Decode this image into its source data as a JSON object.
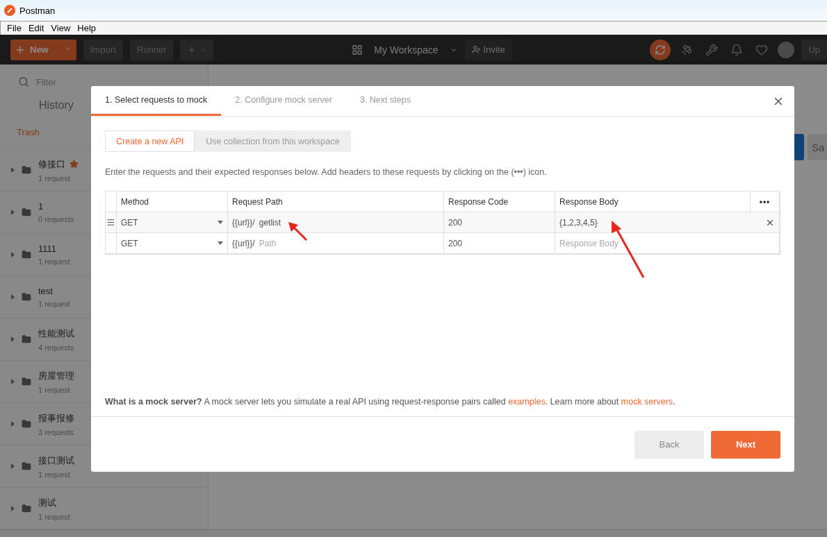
{
  "window": {
    "title": "Postman"
  },
  "menu": [
    "File",
    "Edit",
    "View",
    "Help"
  ],
  "toolbar": {
    "new_button": "New",
    "import_button": "Import",
    "runner_button": "Runner",
    "workspace": "My Workspace",
    "invite_button": "Invite",
    "upgrade_button": "Up"
  },
  "sidebar": {
    "filter_placeholder": "Filter",
    "history_tab": "History",
    "trash_link": "Trash",
    "collections": [
      {
        "name": "修接口",
        "count": "1 request",
        "starred": true
      },
      {
        "name": "1",
        "count": "0 requests",
        "starred": false
      },
      {
        "name": "1111",
        "count": "1 request",
        "starred": false
      },
      {
        "name": "test",
        "count": "1 request",
        "starred": false
      },
      {
        "name": "性能测试",
        "count": "4 requests",
        "starred": false
      },
      {
        "name": "房屋管理",
        "count": "1 request",
        "starred": false
      },
      {
        "name": "报事报修",
        "count": "3 requests",
        "starred": false
      },
      {
        "name": "接口测试",
        "count": "1 request",
        "starred": false
      },
      {
        "name": "测试",
        "count": "1 request",
        "starred": false
      }
    ]
  },
  "main": {
    "save_button": "Sa"
  },
  "modal": {
    "steps": [
      {
        "label": "1. Select requests to mock",
        "selected": true
      },
      {
        "label": "2. Configure mock server",
        "selected": false
      },
      {
        "label": "3. Next steps",
        "selected": false
      }
    ],
    "source_tabs": [
      {
        "label": "Create a new API",
        "selected": true
      },
      {
        "label": "Use collection from this workspace",
        "selected": false
      }
    ],
    "description": "Enter the requests and their expected responses below. Add headers to these requests by clicking on the (•••) icon.",
    "table": {
      "columns": [
        "Method",
        "Request Path",
        "Response Code",
        "Response Body"
      ],
      "menu": "•••",
      "rows": [
        {
          "hovered": true,
          "method": "GET",
          "url_prefix": "{{url}}/",
          "path": "getlist",
          "code": "200",
          "body": "{1,2,3,4,5}"
        },
        {
          "hovered": false,
          "method": "GET",
          "url_prefix": "{{url}}/",
          "path_placeholder": "Path",
          "code": "200",
          "body_placeholder": "Response Body"
        }
      ]
    },
    "info": {
      "lead": "What is a mock server?",
      "text": " A mock server lets you simulate a real API using request-response pairs called ",
      "examples_link": "examples",
      "middle": ". Learn more about ",
      "servers_link": "mock servers",
      "end": "."
    },
    "back_button": "Back",
    "next_button": "Next"
  }
}
